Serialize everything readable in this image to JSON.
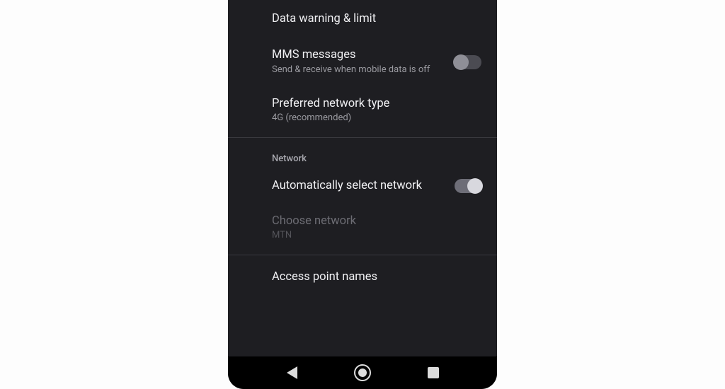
{
  "settings": {
    "dataWarning": {
      "title": "Data warning & limit"
    },
    "mms": {
      "title": "MMS messages",
      "subtitle": "Send & receive when mobile data is off",
      "enabled": false
    },
    "preferredNetwork": {
      "title": "Preferred network type",
      "subtitle": "4G (recommended)"
    },
    "networkSection": {
      "header": "Network"
    },
    "autoSelect": {
      "title": "Automatically select network",
      "enabled": true
    },
    "chooseNetwork": {
      "title": "Choose network",
      "subtitle": "MTN"
    },
    "apn": {
      "title": "Access point names"
    }
  }
}
